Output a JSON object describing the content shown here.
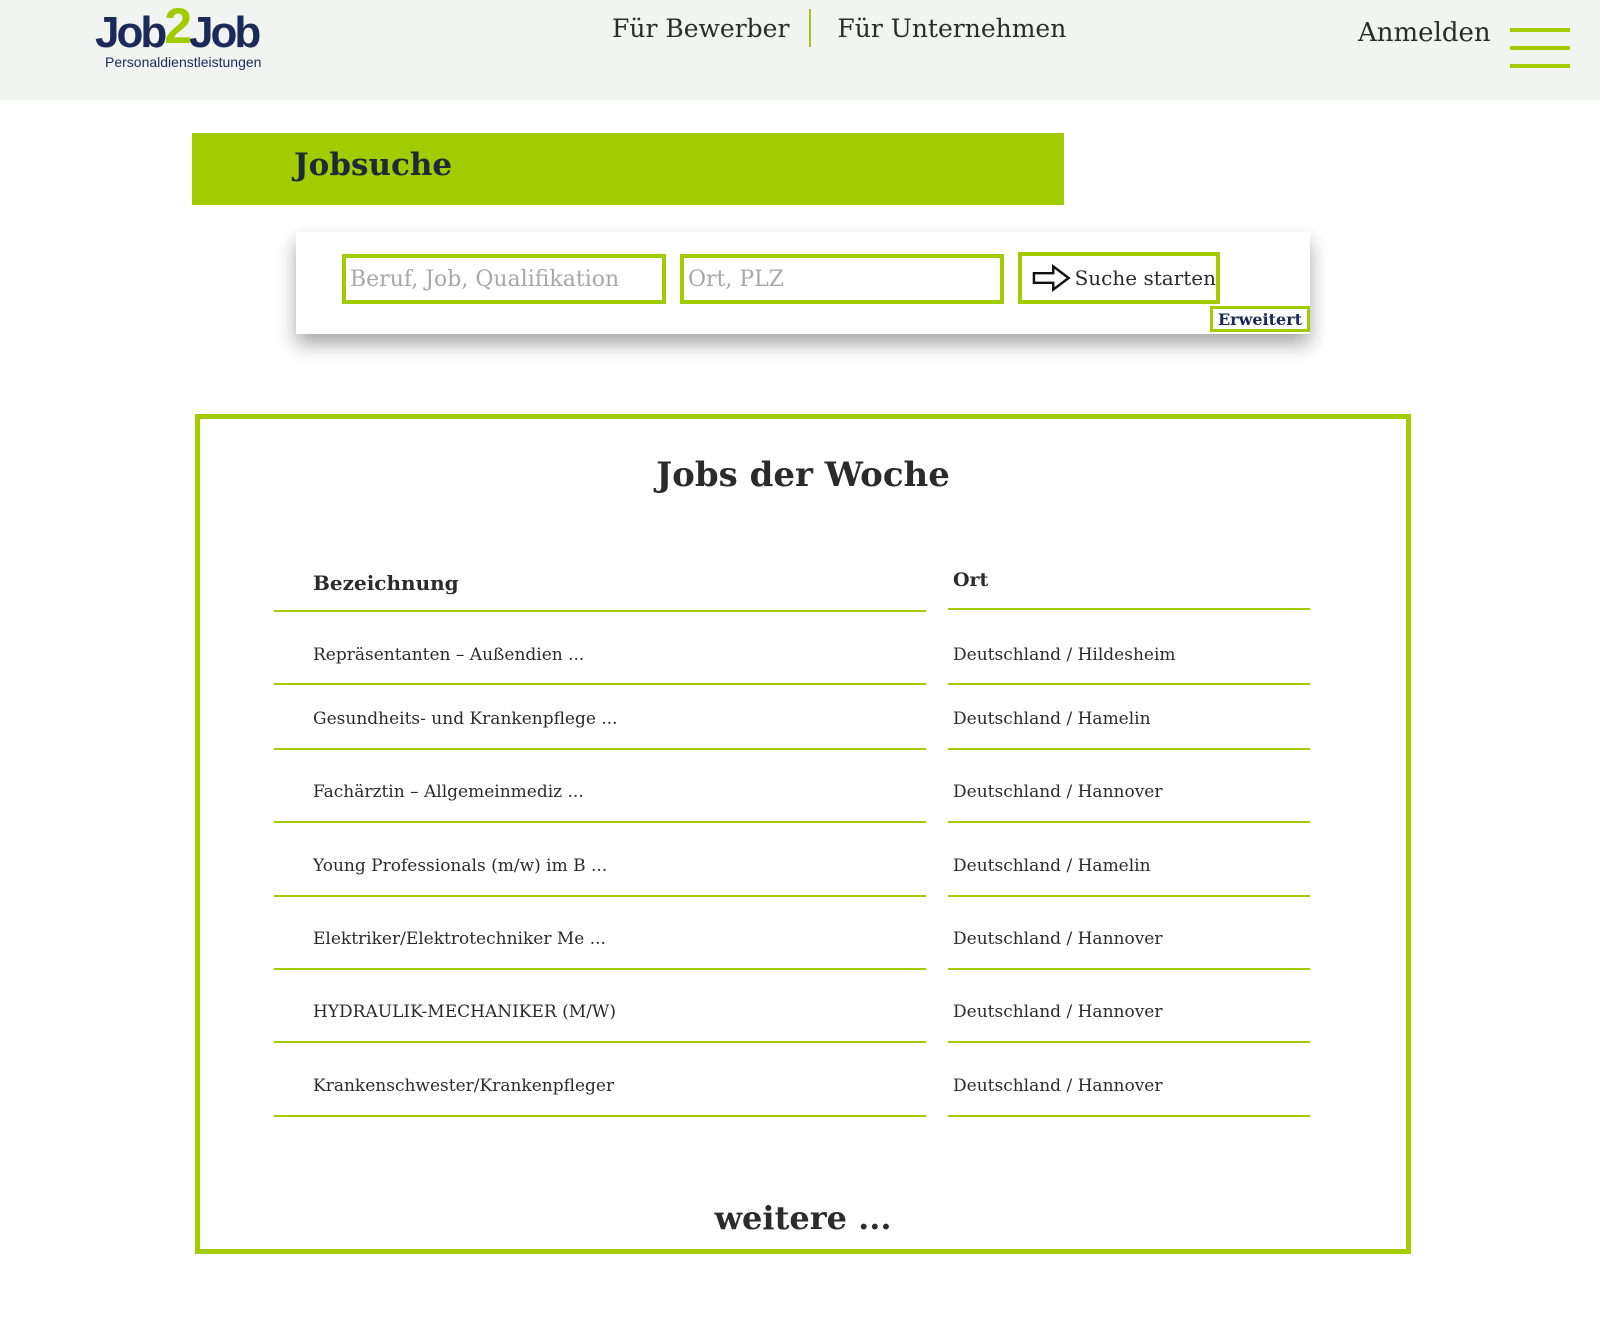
{
  "header": {
    "logo": {
      "main_left": "Job",
      "main_mid": "2",
      "main_right": "Job",
      "subtitle": "Personaldienstleistungen"
    },
    "nav": [
      {
        "label": "Für Bewerber"
      },
      {
        "label": "Für Unternehmen"
      }
    ],
    "login_label": "Anmelden",
    "menu_icon": "hamburger-icon"
  },
  "banner": {
    "title": "Jobsuche"
  },
  "search": {
    "job_placeholder": "Beruf, Job, Qualifikation",
    "job_value": "",
    "place_placeholder": "Ort, PLZ",
    "place_value": "",
    "submit_label": "Suche starten",
    "submit_icon": "arrow-right-icon",
    "advanced_label": "Erweitert"
  },
  "jobs": {
    "title": "Jobs der Woche",
    "columns": {
      "name": "Bezeichnung",
      "place": "Ort"
    },
    "rows": [
      {
        "name": "Repräsentanten – Außendien ...",
        "place": "Deutschland / Hildesheim"
      },
      {
        "name": "Gesundheits- und Krankenpflege ...",
        "place": "Deutschland / Hamelin"
      },
      {
        "name": "Fachärztin – Allgemeinmediz ...",
        "place": "Deutschland / Hannover"
      },
      {
        "name": "Young Professionals (m/w) im B ...",
        "place": "Deutschland / Hamelin"
      },
      {
        "name": "Elektriker/Elektrotechniker Me ...",
        "place": "Deutschland / Hannover"
      },
      {
        "name": "HYDRAULIK-MECHANIKER (M/W)",
        "place": "Deutschland / Hannover"
      },
      {
        "name": "Krankenschwester/Krankenpfleger",
        "place": "Deutschland / Hannover"
      }
    ],
    "more_label": "weitere ..."
  },
  "colors": {
    "accent": "#a3cc00",
    "brand_dark": "#1c2a5a",
    "header_bg": "#f2f4f1"
  }
}
